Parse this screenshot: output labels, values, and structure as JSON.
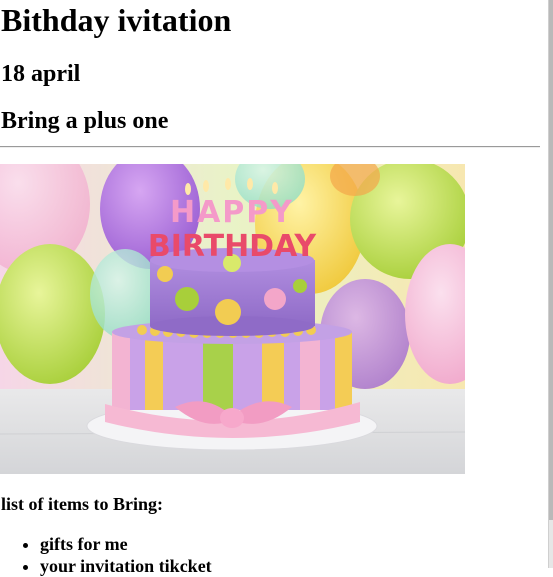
{
  "heading": "Bithday ivitation",
  "date": "18 april",
  "note": "Bring a plus one",
  "image": {
    "cake_text_top": "HAPPY",
    "cake_text_bottom": "BIRTHDAY"
  },
  "list": {
    "title": "list of items to Bring:",
    "items": [
      "gifts for me",
      "your invitation tikcket"
    ]
  }
}
